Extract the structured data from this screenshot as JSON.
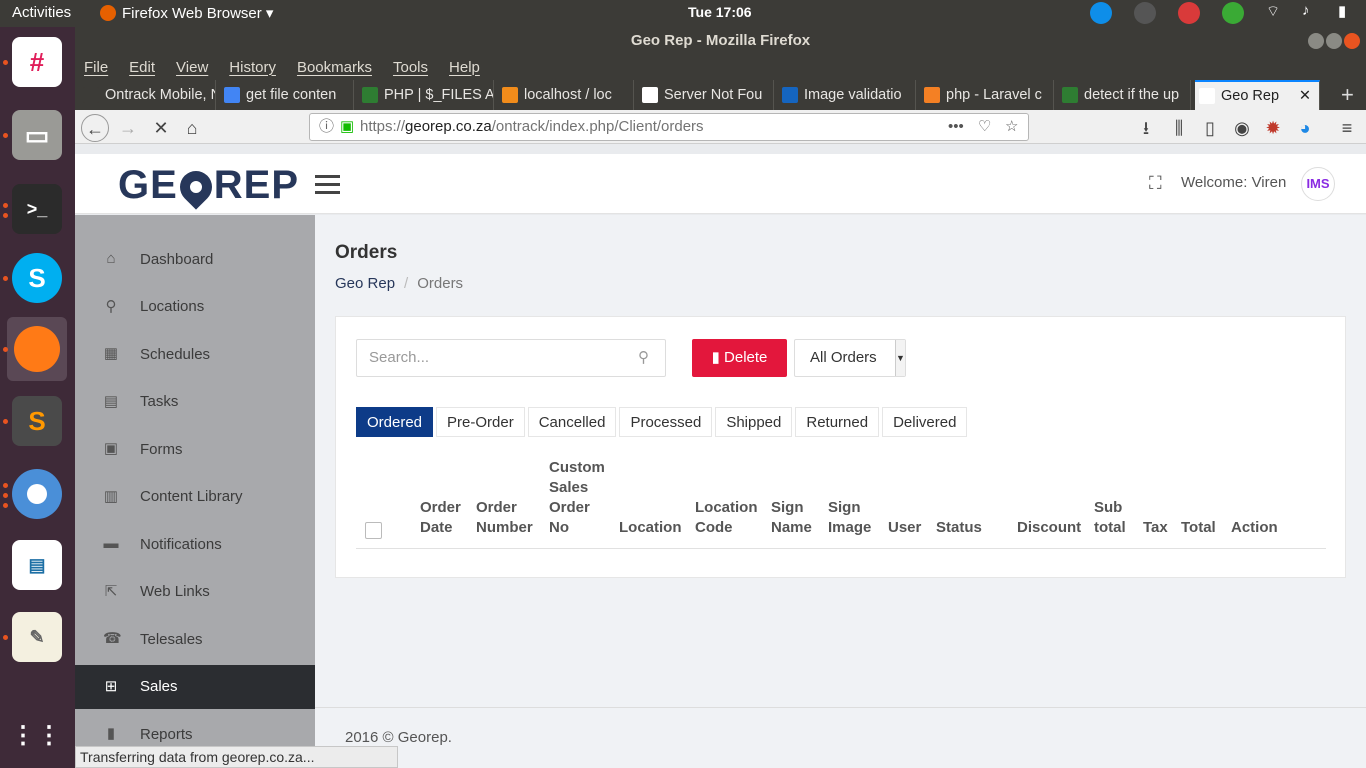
{
  "desktop": {
    "activities": "Activities",
    "app_menu": "Firefox Web Browser ▾",
    "clock": "Tue 17:06"
  },
  "window": {
    "title": "Geo Rep - Mozilla Firefox"
  },
  "menu": [
    "File",
    "Edit",
    "View",
    "History",
    "Bookmarks",
    "Tools",
    "Help"
  ],
  "tabs": [
    {
      "label": "Ontrack Mobile, N",
      "color": "#3c3b37"
    },
    {
      "label": "get file conten",
      "color": "#4285f4"
    },
    {
      "label": "PHP | $_FILES A",
      "color": "#2e7d32"
    },
    {
      "label": "localhost / loc",
      "color": "#f28c1b"
    },
    {
      "label": "Server Not Fou",
      "color": "#ffffff"
    },
    {
      "label": "Image validatio",
      "color": "#1565c0"
    },
    {
      "label": "php - Laravel c",
      "color": "#f48024"
    },
    {
      "label": "detect if the up",
      "color": "#2e7d32"
    },
    {
      "label": "Geo Rep",
      "color": "#ffffff"
    }
  ],
  "nav": {
    "url_prefix": "https://",
    "url_host": "georep.co.za",
    "url_path": "/ontrack/index.php/Client/orders"
  },
  "header": {
    "logo_left": "GE",
    "logo_right": "REP",
    "welcome": "Welcome: Viren",
    "avatar_text": "IMS"
  },
  "sidebar": {
    "items": [
      {
        "label": "Dashboard",
        "icon": "⌂"
      },
      {
        "label": "Locations",
        "icon": "⚲"
      },
      {
        "label": "Schedules",
        "icon": "▦"
      },
      {
        "label": "Tasks",
        "icon": "▤"
      },
      {
        "label": "Forms",
        "icon": "▣"
      },
      {
        "label": "Content Library",
        "icon": "▥"
      },
      {
        "label": "Notifications",
        "icon": "▬"
      },
      {
        "label": "Web Links",
        "icon": "⇱"
      },
      {
        "label": "Telesales",
        "icon": "☎"
      },
      {
        "label": "Sales",
        "icon": "⊞"
      },
      {
        "label": "Reports",
        "icon": "▮"
      }
    ],
    "active_index": 9
  },
  "main": {
    "title": "Orders",
    "breadcrumb_home": "Geo Rep",
    "breadcrumb_sep": "/",
    "breadcrumb_current": "Orders",
    "search_placeholder": "Search...",
    "delete_label": "Delete",
    "filter_value": "All Orders",
    "status_tabs": [
      "Ordered",
      "Pre-Order",
      "Cancelled",
      "Processed",
      "Shipped",
      "Returned",
      "Delivered"
    ],
    "active_status_tab": 0,
    "columns": [
      "Order\nDate",
      "Order\nNumber",
      "Custom\nSales\nOrder\nNo",
      "Location",
      "Location\nCode",
      "Sign\nName",
      "Sign\nImage",
      "User",
      "Status",
      "Discount",
      "Sub\ntotal",
      "Tax",
      "Total",
      "Action"
    ]
  },
  "footer": {
    "text": "2016 © Georep."
  },
  "statusbar": {
    "text": "Transferring data from georep.co.za..."
  },
  "colors": {
    "accent": "#0d3b88",
    "delete": "#e3173c",
    "sidebar_bg": "#a8a9ac",
    "sidebar_active": "#2b2d31"
  }
}
